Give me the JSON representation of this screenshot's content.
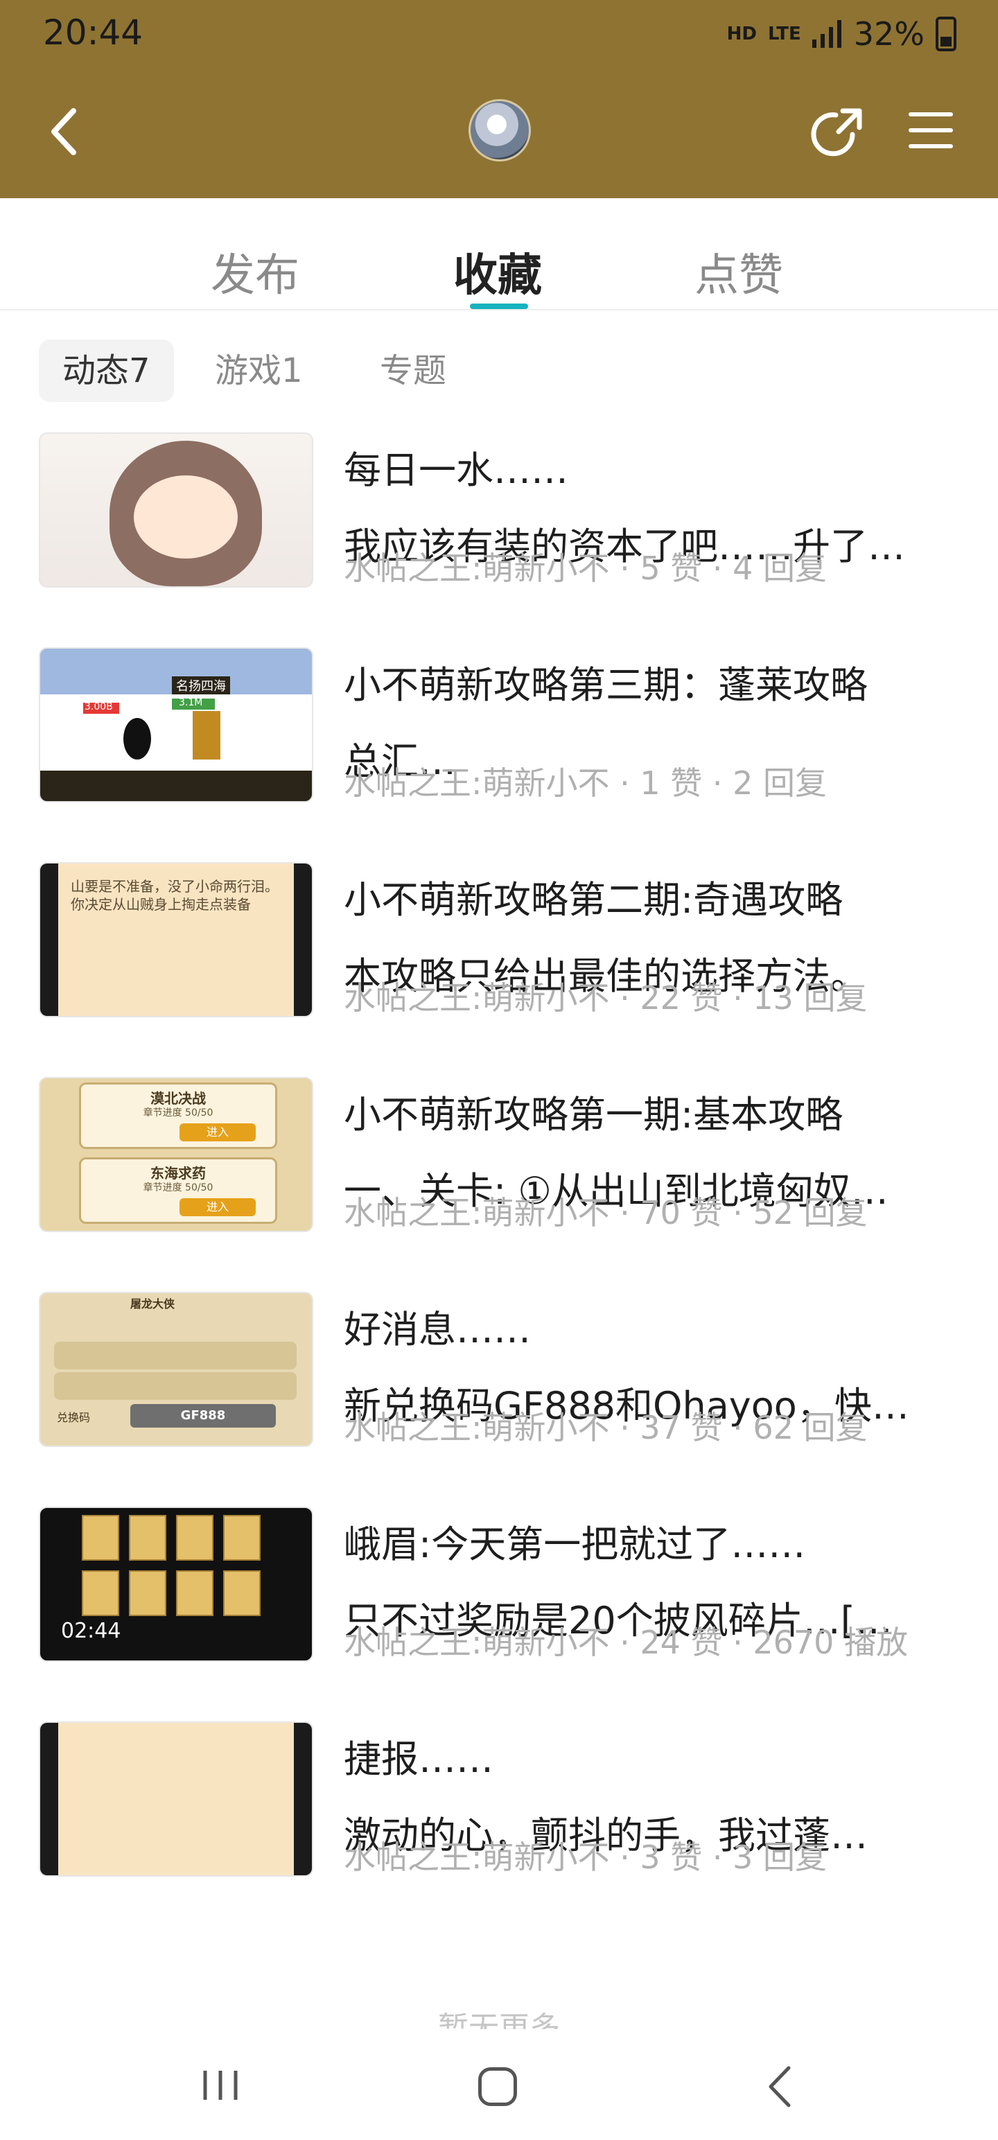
{
  "status_bar": {
    "time": "20:44",
    "hd": "HD",
    "network": "LTE",
    "battery": "32%"
  },
  "header": {
    "back_icon": "chevron-left-icon",
    "avatar": "avatar",
    "share_icon": "share-icon",
    "menu_icon": "menu-icon",
    "bg_color": "#8e7333"
  },
  "tabs": {
    "items": [
      {
        "label": "发布",
        "active": false
      },
      {
        "label": "收藏",
        "active": true
      },
      {
        "label": "点赞",
        "active": false
      }
    ],
    "accent": "#16b3bf"
  },
  "subtabs": {
    "items": [
      {
        "label": "动态7",
        "active": true
      },
      {
        "label": "游戏1",
        "active": false
      },
      {
        "label": "专题",
        "active": false
      }
    ]
  },
  "posts": [
    {
      "title": "每日一水……",
      "summary": "我应该有装的资本了吧……升了…",
      "meta": "水帖之王:萌新小不 · 5 赞 · 4 回复"
    },
    {
      "title": "小不萌新攻略第三期：蓬莱攻略",
      "summary": "总汇…",
      "meta": "水帖之王:萌新小不 · 1 赞 · 2 回复"
    },
    {
      "title": "小不萌新攻略第二期:奇遇攻略",
      "summary": "本攻略只给出最佳的选择方法。",
      "meta": "水帖之王:萌新小不 · 22 赞 · 13 回复"
    },
    {
      "title": "小不萌新攻略第一期:基本攻略",
      "summary": "一、关卡: ①从出山到北境匈奴…",
      "meta": "水帖之王:萌新小不 · 70 赞 · 52 回复"
    },
    {
      "title": "好消息……",
      "summary": "新兑换码GF888和Ohayoo，快…",
      "meta": "水帖之王:萌新小不 · 37 赞 · 62 回复"
    },
    {
      "title": "峨眉:今天第一把就过了……",
      "summary": "只不过奖励是20个披风碎片…[…",
      "meta": "水帖之王:萌新小不 · 24 赞 · 2670 播放",
      "duration": "02:44"
    },
    {
      "title": "捷报……",
      "summary": "激动的心，颤抖的手，我过蓬…",
      "meta": "水帖之王:萌新小不 · 3 赞 · 3 回复"
    }
  ],
  "thumb_text": {
    "p2_label": "名扬四海",
    "p2_hp1": "3.00B",
    "p2_hp2": "3.1M",
    "p3_text": "山要是不准备，没了小命两行泪。你决定从山贼身上掏走点装备",
    "p4_card1": "漠北决战",
    "p4_card2": "东海求药",
    "p4_progress": "章节进度 50/50",
    "p4_enter": "进入",
    "p5_title": "屠龙大侠",
    "p5_code_label": "兑换码",
    "p5_code": "GF888"
  },
  "footer": {
    "no_more": "暂无更多"
  },
  "system_nav": {
    "recent_icon": "recent-apps-icon",
    "home_icon": "home-icon",
    "back_icon": "back-icon"
  }
}
